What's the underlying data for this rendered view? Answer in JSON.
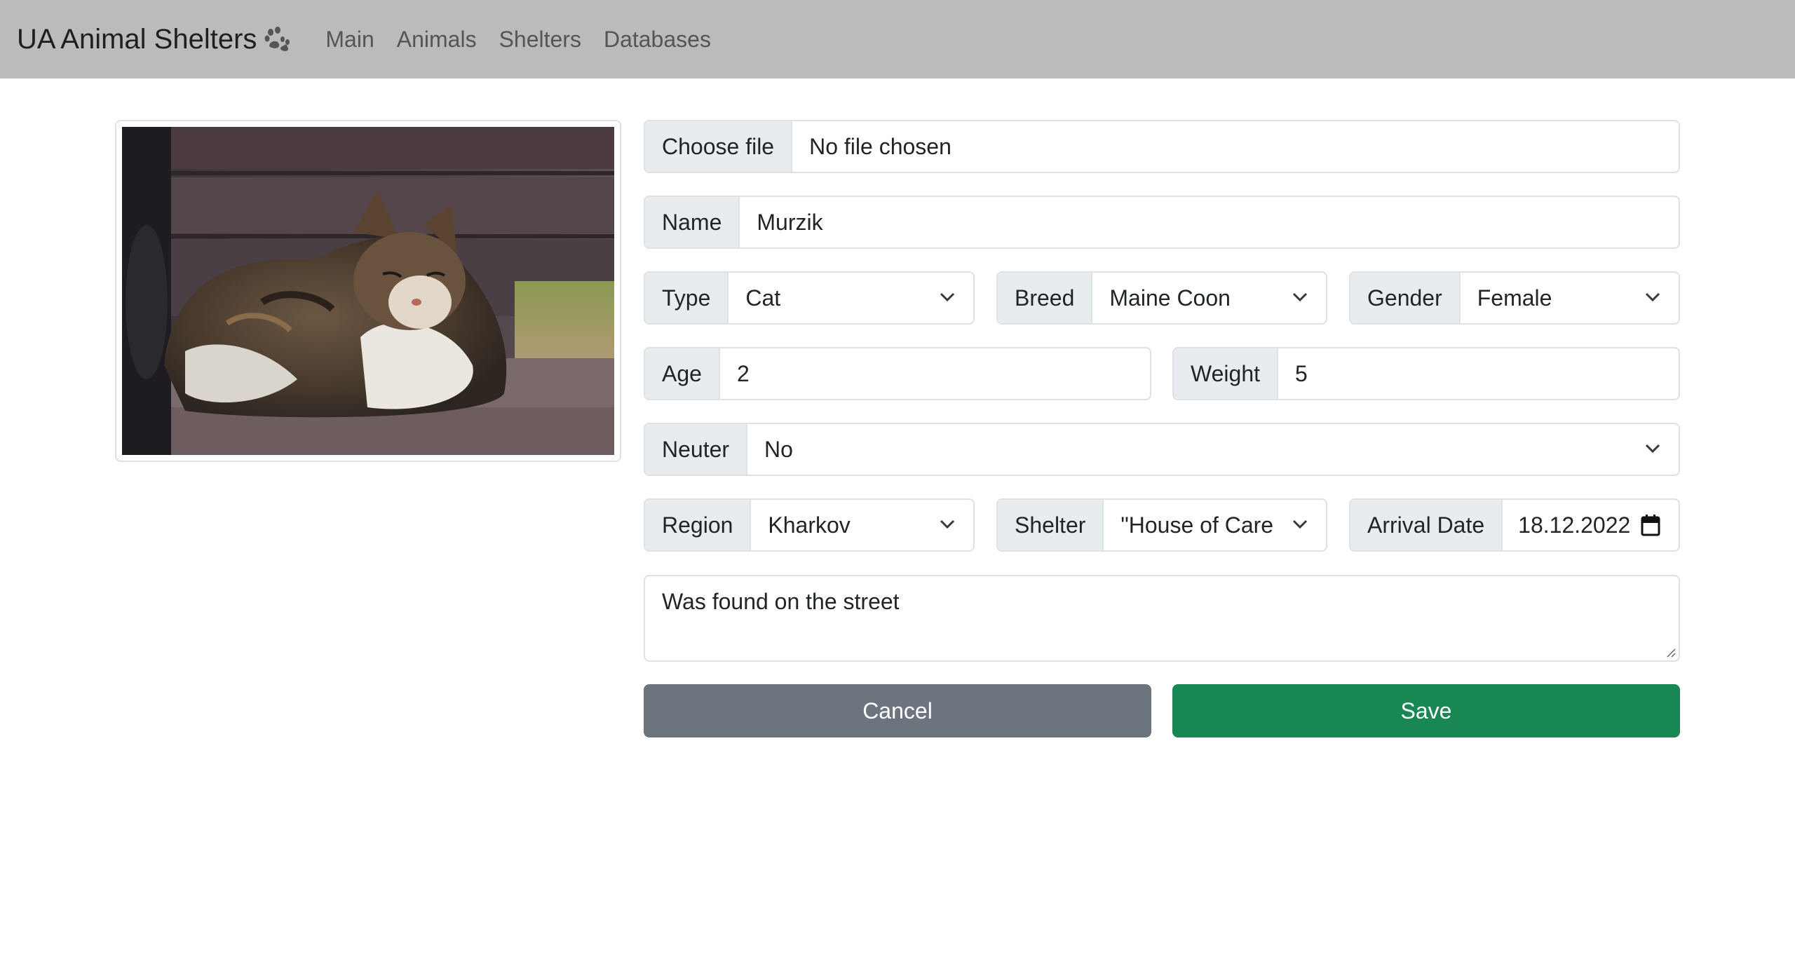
{
  "navbar": {
    "brand": "UA Animal Shelters",
    "brand_icon": "paw-icon",
    "links": [
      "Main",
      "Animals",
      "Shelters",
      "Databases"
    ]
  },
  "photo": {
    "alt_subject": "cat-photo"
  },
  "form": {
    "file": {
      "button_label": "Choose file",
      "status": "No file chosen"
    },
    "name": {
      "label": "Name",
      "value": "Murzik"
    },
    "type": {
      "label": "Type",
      "value": "Cat"
    },
    "breed": {
      "label": "Breed",
      "value": "Maine Coon"
    },
    "gender": {
      "label": "Gender",
      "value": "Female"
    },
    "age": {
      "label": "Age",
      "value": "2"
    },
    "weight": {
      "label": "Weight",
      "value": "5"
    },
    "neuter": {
      "label": "Neuter",
      "value": "No"
    },
    "region": {
      "label": "Region",
      "value": "Kharkov"
    },
    "shelter": {
      "label": "Shelter",
      "value": "\"House of Care"
    },
    "arrival": {
      "label": "Arrival Date",
      "value": "18.12.2022"
    },
    "description": "Was found on the street"
  },
  "actions": {
    "cancel": "Cancel",
    "save": "Save"
  },
  "colors": {
    "navbar": "#bbbbbb",
    "cancel": "#6c757d",
    "save": "#198754",
    "addon": "#e9ecef"
  }
}
